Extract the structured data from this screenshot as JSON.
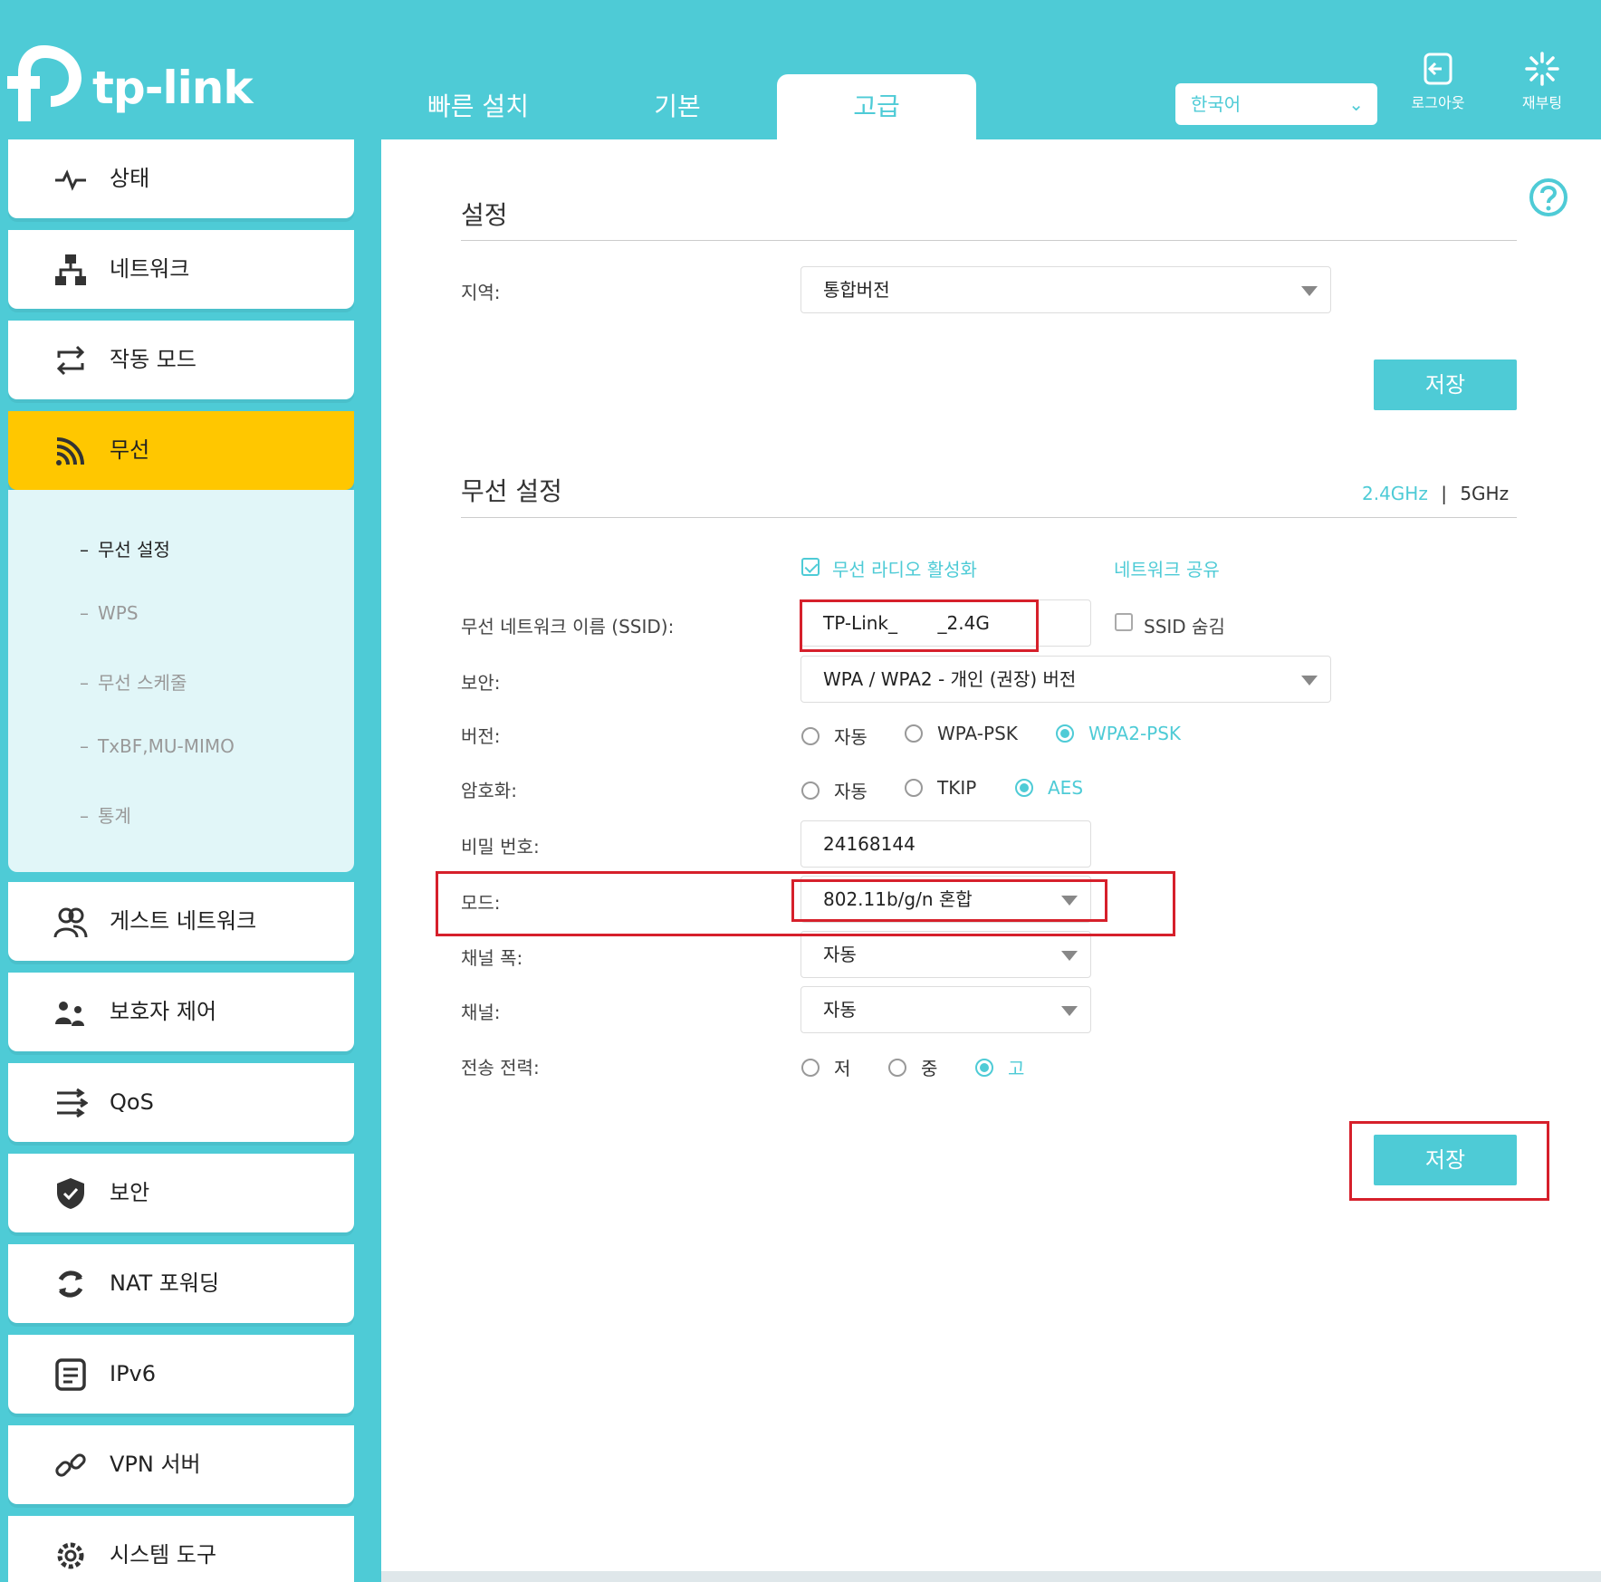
{
  "header": {
    "logo_text": "tp-link",
    "tabs": [
      {
        "label": "빠른 설치"
      },
      {
        "label": "기본"
      },
      {
        "label": "고급"
      }
    ],
    "language": "한국어",
    "logout_label": "로그아웃",
    "reboot_label": "재부팅"
  },
  "sidebar": {
    "items": [
      {
        "label": "상태",
        "icon": "pulse-icon"
      },
      {
        "label": "네트워크",
        "icon": "network-icon"
      },
      {
        "label": "작동 모드",
        "icon": "switch-mode-icon"
      },
      {
        "label": "무선",
        "icon": "wireless-icon"
      },
      {
        "label": "게스트 네트워크",
        "icon": "guest-icon"
      },
      {
        "label": "보호자 제어",
        "icon": "parental-icon"
      },
      {
        "label": "QoS",
        "icon": "qos-icon"
      },
      {
        "label": "보안",
        "icon": "shield-icon"
      },
      {
        "label": "NAT 포워딩",
        "icon": "nat-icon"
      },
      {
        "label": "IPv6",
        "icon": "ipv6-icon"
      },
      {
        "label": "VPN 서버",
        "icon": "link-icon"
      },
      {
        "label": "시스템 도구",
        "icon": "gear-icon"
      }
    ],
    "submenu": [
      {
        "label": "무선 설정"
      },
      {
        "label": "WPS"
      },
      {
        "label": "무선 스케줄"
      },
      {
        "label": "TxBF,MU-MIMO"
      },
      {
        "label": "통계"
      }
    ]
  },
  "settings": {
    "title": "설정",
    "region_label": "지역:",
    "region_value": "통합버전",
    "save_label": "저장"
  },
  "wireless": {
    "title": "무선 설정",
    "band_24": "2.4GHz",
    "band_sep": "|",
    "band_5": "5GHz",
    "enable_radio": "무선 라디오 활성화",
    "share_network": "네트워크 공유",
    "ssid_label": "무선 네트워크 이름 (SSID):",
    "ssid_value": "TP-Link_       _2.4G",
    "hide_ssid": "SSID 숨김",
    "security_label": "보안:",
    "security_value": "WPA / WPA2 - 개인 (권장) 버전",
    "version_label": "버전:",
    "version_options": [
      "자동",
      "WPA-PSK",
      "WPA2-PSK"
    ],
    "encryption_label": "암호화:",
    "encryption_options": [
      "자동",
      "TKIP",
      "AES"
    ],
    "password_label": "비밀 번호:",
    "password_value": "24168144",
    "mode_label": "모드:",
    "mode_value": "802.11b/g/n 혼합",
    "channel_width_label": "채널 폭:",
    "channel_width_value": "자동",
    "channel_label": "채널:",
    "channel_value": "자동",
    "tx_power_label": "전송 전력:",
    "tx_power_options": [
      "저",
      "중",
      "고"
    ],
    "save_label": "저장"
  },
  "colors": {
    "accent": "#4ecbd6",
    "active_menu": "#ffc700",
    "highlight_box": "#d6202b"
  }
}
